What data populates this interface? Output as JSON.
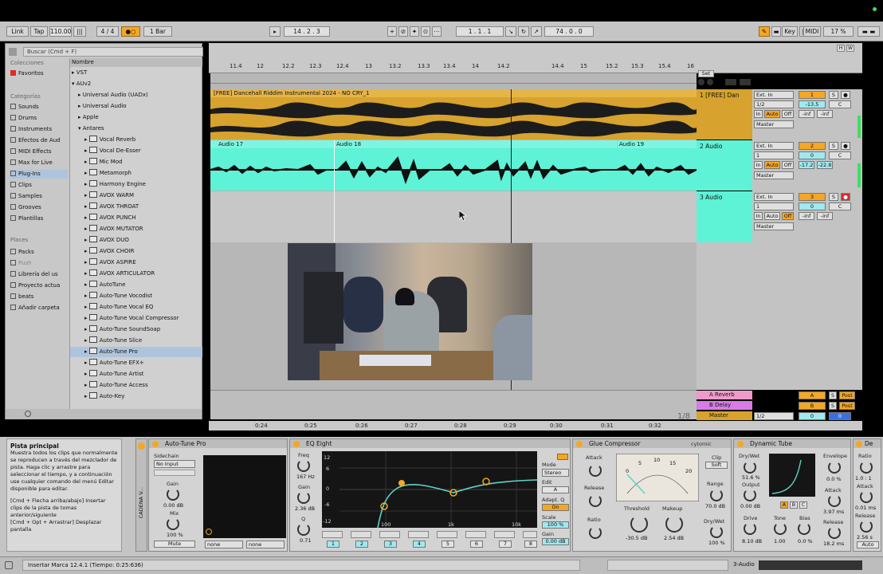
{
  "transport": {
    "link": "Link",
    "tap": "Tap",
    "tempo": "110.00",
    "signature": "4 / 4",
    "metronome": "●○",
    "quantize": "1 Bar",
    "position": "14 .  2 .  3",
    "loop_start": "1 .  1 .  1",
    "loop_length": "74 .  0 .  0",
    "key": "Key",
    "midi": "MIDI",
    "cpu": "17 %"
  },
  "browser": {
    "search_placeholder": "Buscar (Cmd + F)",
    "collections_header": "Colecciones",
    "favorites": "Favoritos",
    "categories_header": "Categorías",
    "categories": [
      "Sounds",
      "Drums",
      "Instruments",
      "Efectos de Aud",
      "MIDI Effects",
      "Max for Live",
      "Plug-Ins",
      "Clips",
      "Samples",
      "Grooves",
      "Plantillas"
    ],
    "places_header": "Places",
    "places": [
      "Packs",
      "Push",
      "Librería del us",
      "Proyecto actua",
      "beats",
      "Añadir carpeta"
    ],
    "name_header": "Nombre",
    "items": [
      "VST",
      "AUv2",
      "Universal Audio (UADx)",
      "Universal Audio",
      "Apple",
      "Antares",
      "Vocal Reverb",
      "Vocal De-Esser",
      "Mic Mod",
      "Metamorph",
      "Harmony Engine",
      "AVOX WARM",
      "AVOX THROAT",
      "AVOX PUNCH",
      "AVOX MUTATOR",
      "AVOX DUO",
      "AVOX CHOIR",
      "AVOX ASPIRE",
      "AVOX ARTICULATOR",
      "AutoTune",
      "Auto-Tune Vocodist",
      "Auto-Tune Vocal EQ",
      "Auto-Tune Vocal Compressor",
      "Auto-Tune SoundSoap",
      "Auto-Tune Slice",
      "Auto-Tune Pro",
      "Auto-Tune EFX+",
      "Auto-Tune Artist",
      "Auto-Tune Access",
      "Auto-Key"
    ]
  },
  "ruler": {
    "bars": [
      "11.4",
      "12",
      "12.2",
      "12.3",
      "12.4",
      "13",
      "13.2",
      "13.3",
      "13.4",
      "14",
      "14.2",
      "14.4",
      "15",
      "15.2",
      "15.3",
      "15.4",
      "16"
    ],
    "times": [
      "0:24",
      "0:25",
      "0:26",
      "0:27",
      "0:28",
      "0:29",
      "0:30",
      "0:31",
      "0:32"
    ],
    "set_label": "Set",
    "zoom": "1/8"
  },
  "tracks": [
    {
      "clip": "[FREE] Dancehall Riddim Instrumental 2024 - NO CRY_1",
      "name": "1 [FREE] Dan",
      "input": "Ext. In",
      "channel": "1/2",
      "out": "Master",
      "number": "1",
      "vol": "-13.5",
      "pan": "C",
      "peak1": "-inf",
      "peak2": "-inf"
    },
    {
      "clips": [
        "Audio 17",
        "Audio 18",
        "Audio 19"
      ],
      "name": "2 Audio",
      "input": "Ext. In",
      "channel": "1",
      "out": "Master",
      "number": "2",
      "vol": "0",
      "pan": "C",
      "peak1": "-17.2",
      "peak2": "-22.8"
    },
    {
      "name": "3 Audio",
      "input": "Ext. In",
      "channel": "1",
      "out": "Master",
      "number": "3",
      "vol": "0",
      "pan": "C",
      "peak1": "-inf",
      "peak2": "-inf"
    }
  ],
  "monitor": {
    "in": "In",
    "auto": "Auto",
    "off": "Off"
  },
  "returns": [
    {
      "name": "A Reverb",
      "letter": "A",
      "post": "Post"
    },
    {
      "name": "B Delay",
      "letter": "B",
      "post": "Post"
    },
    {
      "name": "Master",
      "channel": "1/2",
      "vol": "0",
      "pan": "0"
    }
  ],
  "info": {
    "title": "Pista principal",
    "text": "Muestra todos los clips que normalmente se reproducen a través del mezclador de pista. Haga clic y arrastre para seleccionar el tiempo, y a continuación use cualquier comando del menú Editar disponible para editar.",
    "shortcut1": "[Cmd + Flecha arriba/abajo] Insertar clips de la pista de tomas anterior/siguiente",
    "shortcut2": "[Cmd + Opt + Arrastrar] Desplazar pantalla"
  },
  "devices": {
    "chain_label": "CADENA V...",
    "autotune": {
      "title": "Auto-Tune Pro",
      "sidechain": "Sidechain",
      "sc_value": "No Input",
      "gain": "Gain",
      "gain_val": "0.00 dB",
      "mix": "Mix",
      "mix_val": "100 %",
      "mute": "Mute",
      "none1": "none",
      "none2": "none"
    },
    "eq": {
      "title": "EQ Eight",
      "freq": "Freq",
      "freq_val": "167 Hz",
      "gain": "Gain",
      "gain_val": "2.36 dB",
      "q": "Q",
      "q_val": "0.71",
      "mode": "Mode",
      "mode_val": "Stereo",
      "edit": "Edit",
      "adapt": "Adapt. Q",
      "adapt_val": "On",
      "scale": "Scale",
      "scale_val": "100 %",
      "gain2": "Gain",
      "gain2_val": "0.00 dB",
      "db_ticks": [
        "12",
        "6",
        "0",
        "-6",
        "-12"
      ],
      "freq_ticks": [
        "100",
        "1k",
        "10k"
      ],
      "bands": [
        "1",
        "2",
        "3",
        "4",
        "5",
        "6",
        "7",
        "8"
      ]
    },
    "glue": {
      "title": "Glue Compressor",
      "brand": "cytomic",
      "attack": "Attack",
      "release": "Release",
      "ratio": "Ratio",
      "threshold": "Threshold",
      "threshold_val": "-30.5 dB",
      "makeup": "Makeup",
      "makeup_val": "2.54 dB",
      "clip": "Clip",
      "soft": "Soft",
      "range": "Range",
      "range_val": "70.0 dB",
      "drywet": "Dry/Wet",
      "drywet_val": "100 %",
      "meter_ticks": [
        "0",
        "5",
        "10",
        "15",
        "20"
      ]
    },
    "tube": {
      "title": "Dynamic Tube",
      "drywet": "Dry/Wet",
      "drywet_val": "51.6 %",
      "output": "Output",
      "output_val": "0.00 dB",
      "drive": "Drive",
      "drive_val": "8.10 dB",
      "tone": "Tone",
      "tone_val": "1.00",
      "bias": "Bias",
      "bias_val": "0.0 %",
      "envelope": "Envelope",
      "env_val": "0.0 %",
      "attack": "Attack",
      "attack_val": "3.97 ms",
      "release": "Release",
      "release_val": "18.2 ms",
      "abc": [
        "A",
        "B",
        "C"
      ]
    },
    "partial": {
      "title": "De",
      "ratio": "Ratio",
      "ratio_val": "1.0 : 1",
      "attack": "Attack",
      "attack_val": "0.01 ms",
      "release": "Release",
      "release_val": "2.56 s",
      "auto": "Auto"
    }
  },
  "status": {
    "text": "Insertar Marca 12.4.1 (Tiempo: 0:25:636)",
    "track": "3-Audio"
  }
}
